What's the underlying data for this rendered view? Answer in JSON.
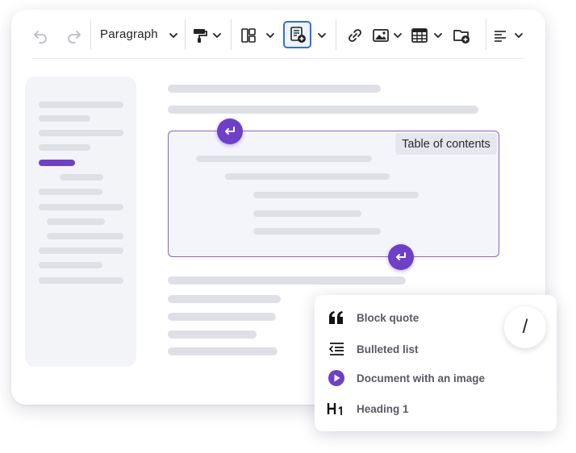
{
  "toolbar": {
    "undo_icon": "undo-icon",
    "redo_icon": "redo-icon",
    "paragraph_label": "Paragraph",
    "format_painter_icon": "paint-roller-icon",
    "layout_icon": "layout-icon",
    "toc_insert_icon": "document-insert-icon",
    "link_icon": "link-icon",
    "image_icon": "image-icon",
    "table_icon": "table-icon",
    "folder_icon": "folder-add-icon",
    "align_icon": "align-left-icon"
  },
  "toc": {
    "badge_label": "Table of contents"
  },
  "slash_menu": {
    "trigger": "/",
    "items": [
      {
        "label": "Block quote",
        "icon": "quote-icon"
      },
      {
        "label": "Bulleted list",
        "icon": "list-indent-icon"
      },
      {
        "label": "Document with an image",
        "icon": "play-circle-icon"
      },
      {
        "label": "Heading 1",
        "icon": "heading-icon"
      }
    ]
  },
  "colors": {
    "accent": "#6e3fc9",
    "active_border": "#2f6fdf",
    "placeholder_bar": "#dfe0e6"
  }
}
